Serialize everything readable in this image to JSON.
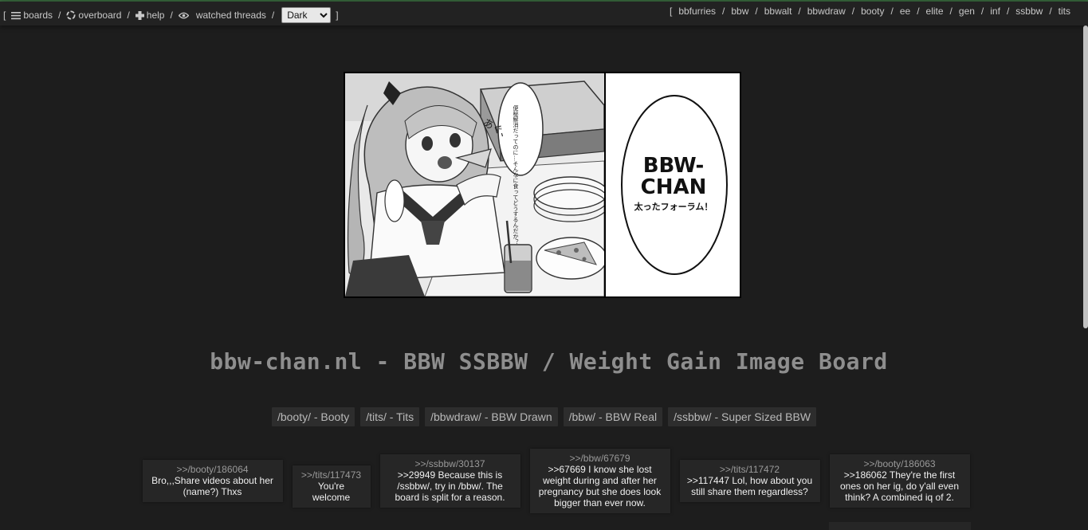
{
  "nav": {
    "open_bracket": "[",
    "close_bracket": "]",
    "left_links": [
      {
        "label": "boards",
        "icon": "menu-icon"
      },
      {
        "label": "overboard",
        "icon": "recycle-icon"
      },
      {
        "label": "help",
        "icon": "plus-icon"
      },
      {
        "label": "watched threads",
        "icon": "eye-icon"
      }
    ],
    "theme_selected": "Dark",
    "board_links": [
      "bbfurries",
      "bbw",
      "bbwalt",
      "bbwdraw",
      "booty",
      "ee",
      "elite",
      "gen",
      "inf",
      "ssbbw",
      "tits"
    ]
  },
  "banner": {
    "heading_line1": "BBW-",
    "heading_line2": "CHAN",
    "subtitle": "太ったフォーラム！",
    "sfx": "あぐ、",
    "speech": "便秘解消だってのに…そんなに食ってどうするんだか？"
  },
  "site_title": "bbw-chan.nl - BBW SSBBW / Weight Gain Image Board",
  "featured_boards": [
    "/booty/ - Booty",
    "/tits/ - Tits",
    "/bbwdraw/ - BBW Drawn",
    "/bbw/ - BBW Real",
    "/ssbbw/ - Super Sized BBW"
  ],
  "recent_posts": [
    {
      "ref": ">>/booty/186064",
      "text": "Bro,,,Share videos about her (name?) Thxs",
      "width": 160
    },
    {
      "ref": ">>/tits/117473",
      "text": "You're welcome",
      "width": 80
    },
    {
      "ref": ">>/ssbbw/30137",
      "text": ">>29949 Because this is /ssbbw/, try in /bbw/. The board is split for a reason.",
      "width": 160
    },
    {
      "ref": ">>/bbw/67679",
      "text": ">>67669 I know she lost weight during and after her pregnancy but she does look bigger than ever now.",
      "width": 160
    },
    {
      "ref": ">>/tits/117472",
      "text": ">>117447 Lol, how about you still share them regardless?",
      "width": 160
    },
    {
      "ref": ">>/booty/186063",
      "text": ">>186062 They're the first ones on her ig, do y'all even think? A combined iq of 2.",
      "width": 160
    }
  ]
}
